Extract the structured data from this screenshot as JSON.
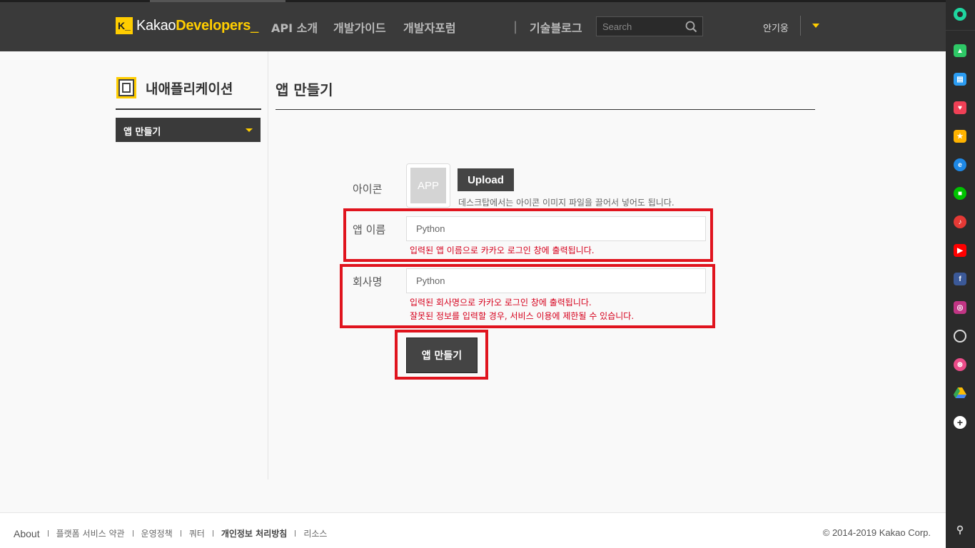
{
  "header": {
    "logo_mark": "K_",
    "logo_prefix": "Kakao",
    "logo_bold": "Developers",
    "logo_cursor": "_",
    "nav": [
      "API 소개",
      "개발가이드",
      "개발자포럼"
    ],
    "nav_sep": "|",
    "blog": "기술블로그",
    "search_placeholder": "Search",
    "user_name": "안기웅"
  },
  "sidebar": {
    "title": "내애플리케이션",
    "menu_label": "앱 만들기"
  },
  "main": {
    "page_title": "앱 만들기",
    "icon_label": "아이콘",
    "app_placeholder": "APP",
    "upload_label": "Upload",
    "upload_hint": "데스크탑에서는 아이콘 이미지 파일을 끌어서 넣어도 됩니다.",
    "app_name_label": "앱 이름",
    "app_name_value": "Python",
    "app_name_hint": "입력된 앱 이름으로 카카오 로그인 창에 출력됩니다.",
    "company_label": "회사명",
    "company_value": "Python",
    "company_hint_1": "입력된 회사명으로 카카오 로그인 창에 출력됩니다.",
    "company_hint_2": "잘못된 정보를 입력할 경우, 서비스 이용에 제한될 수 있습니다.",
    "submit_label": "앱 만들기",
    "highlight_color": "#e0141e"
  },
  "footer": {
    "links": [
      "About",
      "플랫폼 서비스 약관",
      "운영정책",
      "쿼터",
      "개인정보 처리방침",
      "리소스"
    ],
    "copyright": "© 2014-2019 Kakao Corp."
  },
  "browser_sidebar": {
    "icons": [
      "status-icon",
      "notification-icon",
      "storage-icon",
      "pocket-icon",
      "bookmark-star-icon",
      "edge-icon",
      "line-icon",
      "music-icon",
      "youtube-icon",
      "facebook-icon",
      "instagram-icon",
      "clock-icon",
      "dribbble-icon",
      "google-drive-icon",
      "add-icon",
      "pin-icon"
    ]
  },
  "colors": {
    "brand": "#ffcd00",
    "header_bg": "#3a3a3a",
    "error": "#d6001c"
  }
}
